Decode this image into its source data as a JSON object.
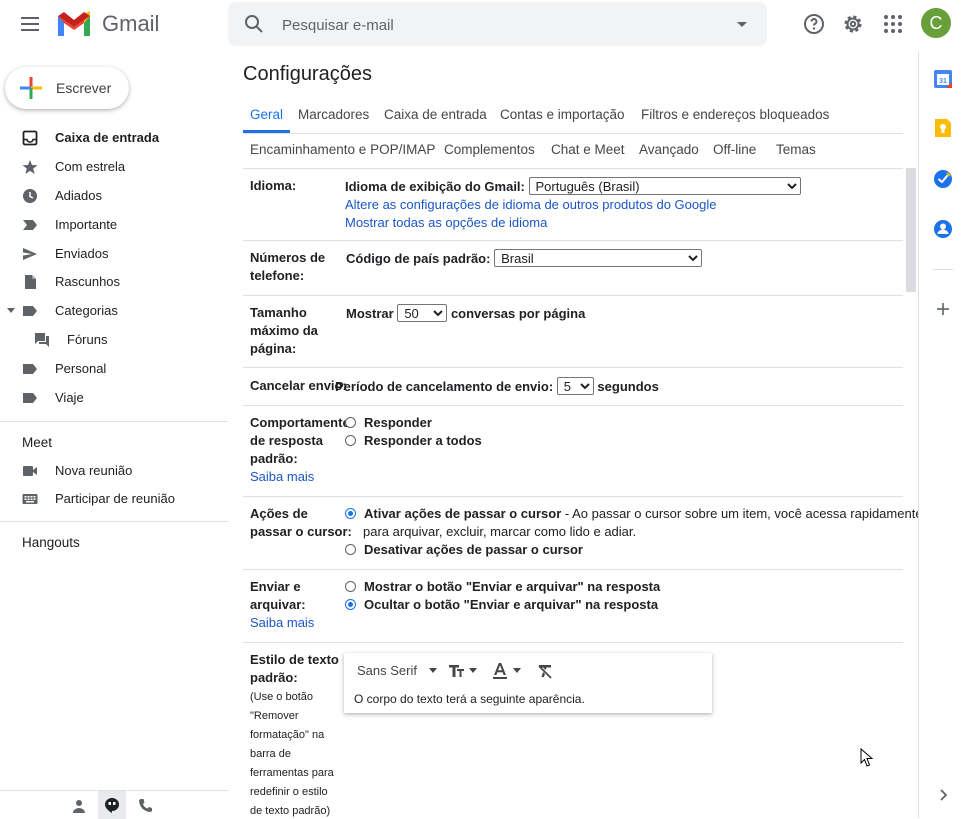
{
  "app": {
    "name": "Gmail",
    "avatar_letter": "C"
  },
  "search": {
    "placeholder": "Pesquisar e-mail"
  },
  "compose": {
    "label": "Escrever"
  },
  "nav": [
    {
      "label": "Caixa de entrada",
      "icon": "inbox-icon",
      "active": true
    },
    {
      "label": "Com estrela",
      "icon": "star-icon"
    },
    {
      "label": "Adiados",
      "icon": "clock-icon"
    },
    {
      "label": "Importante",
      "icon": "important-icon"
    },
    {
      "label": "Enviados",
      "icon": "send-icon"
    },
    {
      "label": "Rascunhos",
      "icon": "draft-icon"
    },
    {
      "label": "Categorias",
      "icon": "label-icon"
    },
    {
      "label": "Fóruns",
      "icon": "forum-icon"
    },
    {
      "label": "Personal",
      "icon": "label-icon"
    },
    {
      "label": "Viaje",
      "icon": "label-icon"
    }
  ],
  "meet": {
    "title": "Meet",
    "items": [
      "Nova reunião",
      "Participar de reunião"
    ]
  },
  "hangouts": {
    "title": "Hangouts"
  },
  "settings": {
    "title": "Configurações",
    "tabs_row1": [
      "Geral",
      "Marcadores",
      "Caixa de entrada",
      "Contas e importação",
      "Filtros e endereços bloqueados"
    ],
    "tabs_row2": [
      "Encaminhamento e POP/IMAP",
      "Complementos",
      "Chat e Meet",
      "Avançado",
      "Off-line",
      "Temas"
    ],
    "language": {
      "label": "Idioma:",
      "display_label": "Idioma de exibição do Gmail:",
      "display_value": "Português (Brasil)",
      "link1": "Altere as configurações de idioma de outros produtos do Google",
      "link2": "Mostrar todas as opções de idioma"
    },
    "phone": {
      "label_l1": "Números de",
      "label_l2": "telefone:",
      "field_label": "Código de país padrão:",
      "value": "Brasil"
    },
    "page_size": {
      "label_l1": "Tamanho",
      "label_l2": "máximo da",
      "label_l3": "página:",
      "prefix": "Mostrar",
      "value": "50",
      "suffix": "conversas por página"
    },
    "undo_send": {
      "label": "Cancelar envio:",
      "prefix": "Período de cancelamento de envio:",
      "value": "5",
      "suffix": "segundos"
    },
    "reply": {
      "label_l1": "Comportamento",
      "label_l2": "de resposta",
      "label_l3": "padrão:",
      "learn_more": "Saiba mais",
      "opt1": "Responder",
      "opt2": "Responder a todos"
    },
    "hover": {
      "label_l1": "Ações de",
      "label_l2": "passar o cursor:",
      "opt1": "Ativar ações de passar o cursor",
      "opt1_desc": " - Ao passar o cursor sobre um item, você acessa rapidamente",
      "opt1_desc2": "para arquivar, excluir, marcar como lido e adiar.",
      "opt2": "Desativar ações de passar o cursor"
    },
    "send_archive": {
      "label_l1": "Enviar e",
      "label_l2": "arquivar:",
      "learn_more": "Saiba mais",
      "opt1": "Mostrar o botão \"Enviar e arquivar\" na resposta",
      "opt2": "Ocultar o botão \"Enviar e arquivar\" na resposta"
    },
    "text_style": {
      "label_l1": "Estilo de texto",
      "label_l2": "padrão:",
      "note": [
        "(Use o botão",
        "\"Remover",
        "formatação\" na",
        "barra de",
        "ferramentas para",
        "redefinir o estilo",
        "de texto padrão)"
      ],
      "font": "Sans Serif",
      "preview": "O corpo do texto terá a seguinte aparência."
    }
  },
  "colors": {
    "accent": "#1a73e8",
    "avatar": "#689f38"
  }
}
